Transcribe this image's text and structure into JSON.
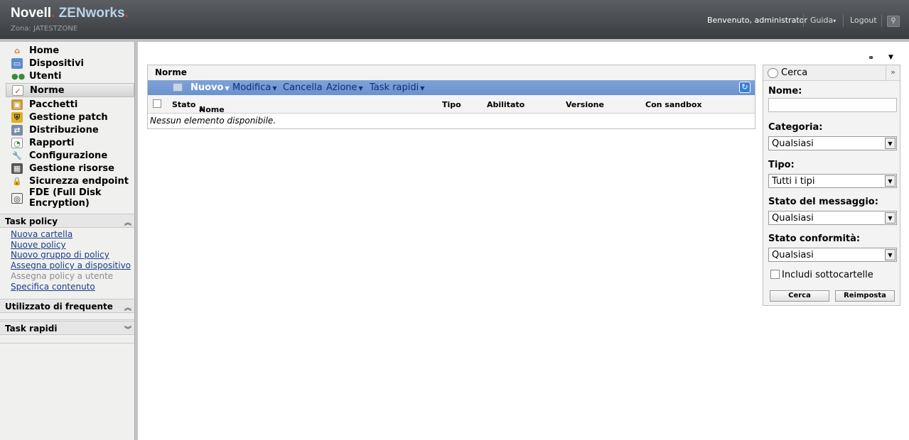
{
  "header": {
    "brand_novell": "Novell",
    "brand_dot": ".",
    "brand_zen": "ZENworks",
    "brand_suffix": ".",
    "zone": "Zona: JATESTZONE",
    "welcome": "Benvenuto, administrator",
    "guida": "Guida",
    "logout": "Logout"
  },
  "nav": {
    "items": [
      {
        "label": "Home",
        "icon": "home-icon"
      },
      {
        "label": "Dispositivi",
        "icon": "monitor-icon"
      },
      {
        "label": "Utenti",
        "icon": "users-icon"
      },
      {
        "label": "Norme",
        "icon": "policy-icon",
        "active": true
      },
      {
        "label": "Pacchetti",
        "icon": "package-icon"
      },
      {
        "label": "Gestione patch",
        "icon": "patch-shield-icon"
      },
      {
        "label": "Distribuzione",
        "icon": "distribution-icon"
      },
      {
        "label": "Rapporti",
        "icon": "reports-icon"
      },
      {
        "label": "Configurazione",
        "icon": "wrench-icon"
      },
      {
        "label": "Gestione risorse",
        "icon": "asset-icon"
      },
      {
        "label": "Sicurezza endpoint",
        "icon": "lock-icon"
      },
      {
        "label": "FDE (Full Disk",
        "label2": "Encryption)",
        "icon": "disk-encryption-icon"
      }
    ]
  },
  "sections": {
    "task_policy": {
      "title": "Task policy",
      "links": [
        {
          "label": "Nuova cartella",
          "enabled": true
        },
        {
          "label": "Nuove policy",
          "enabled": true
        },
        {
          "label": "Nuovo gruppo di policy",
          "enabled": true
        },
        {
          "label": "Assegna policy a dispositivo",
          "enabled": true
        },
        {
          "label": "Assegna policy a utente",
          "enabled": false
        },
        {
          "label": "Specifica contenuto",
          "enabled": true
        }
      ]
    },
    "frequent": {
      "title": "Utilizzato di frequente"
    },
    "quick": {
      "title": "Task rapidi"
    }
  },
  "main": {
    "title": "Norme",
    "toolbar": {
      "nuovo": "Nuovo",
      "modifica": "Modifica",
      "cancella": "Cancella",
      "azione": "Azione",
      "task_rapidi": "Task rapidi"
    },
    "columns": [
      "Stato",
      "Nome",
      "Tipo",
      "Abilitato",
      "Versione",
      "Con sandbox"
    ],
    "empty": "Nessun elemento disponibile."
  },
  "search": {
    "title": "Cerca",
    "nome_label": "Nome:",
    "nome_value": "",
    "categoria_label": "Categoria:",
    "categoria_value": "Qualsiasi",
    "tipo_label": "Tipo:",
    "tipo_value": "Tutti i tipi",
    "stato_msg_label": "Stato del messaggio:",
    "stato_msg_value": "Qualsiasi",
    "stato_conf_label": "Stato conformità:",
    "stato_conf_value": "Qualsiasi",
    "includi_label": "Includi sottocartelle",
    "cerca_button": "Cerca",
    "reimposta_button": "Reimposta"
  },
  "colors": {
    "header": "#45494d",
    "toolbar": "#7299d3",
    "brand_accent": "#b6d2ea",
    "link": "#1b3d87"
  }
}
